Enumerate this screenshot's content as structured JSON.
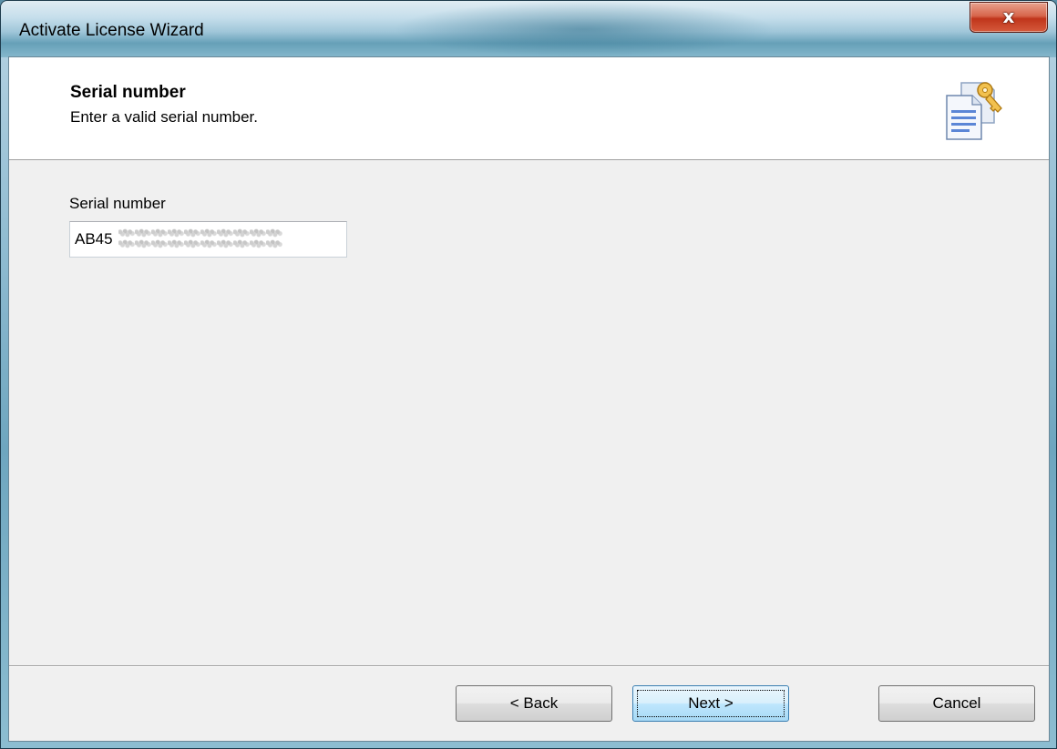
{
  "window": {
    "title": "Activate License Wizard",
    "close_glyph": "x"
  },
  "header": {
    "title": "Serial number",
    "subtitle": "Enter a valid serial number.",
    "icon": "license-key-document-icon"
  },
  "form": {
    "serial_label": "Serial number",
    "serial_value": "AB45"
  },
  "buttons": {
    "back": "< Back",
    "next": "Next >",
    "cancel": "Cancel"
  },
  "colors": {
    "close_button": "#c0351b",
    "default_button_border": "#3c7fb1"
  }
}
